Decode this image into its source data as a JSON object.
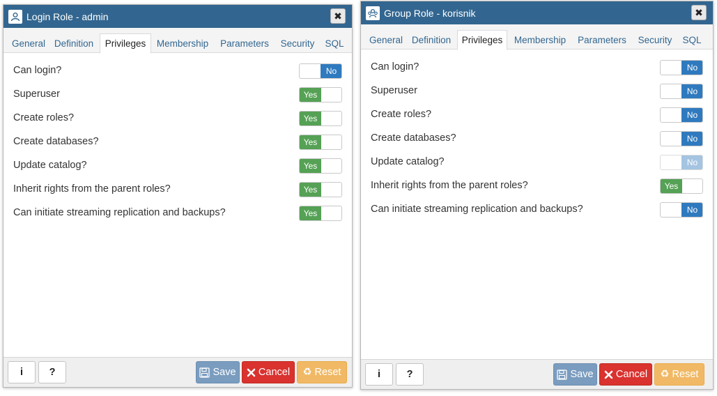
{
  "dialogs": [
    {
      "title": "Login Role - admin",
      "icon": "user-role-icon",
      "close_glyph": "✖",
      "tabs": [
        "General",
        "Definition",
        "Privileges",
        "Membership",
        "Parameters",
        "Security",
        "SQL"
      ],
      "active_tab": "Privileges",
      "privileges": [
        {
          "label": "Can login?",
          "value": "No"
        },
        {
          "label": "Superuser",
          "value": "Yes"
        },
        {
          "label": "Create roles?",
          "value": "Yes"
        },
        {
          "label": "Create databases?",
          "value": "Yes"
        },
        {
          "label": "Update catalog?",
          "value": "Yes"
        },
        {
          "label": "Inherit rights from the parent roles?",
          "value": "Yes"
        },
        {
          "label": "Can initiate streaming replication and backups?",
          "value": "Yes"
        }
      ],
      "footer": {
        "info": "i",
        "help": "?",
        "save": "Save",
        "cancel": "Cancel",
        "reset": "Reset"
      }
    },
    {
      "title": "Group Role - korisnik",
      "icon": "group-role-icon",
      "close_glyph": "✖",
      "tabs": [
        "General",
        "Definition",
        "Privileges",
        "Membership",
        "Parameters",
        "Security",
        "SQL"
      ],
      "active_tab": "Privileges",
      "privileges": [
        {
          "label": "Can login?",
          "value": "No"
        },
        {
          "label": "Superuser",
          "value": "No"
        },
        {
          "label": "Create roles?",
          "value": "No"
        },
        {
          "label": "Create databases?",
          "value": "No"
        },
        {
          "label": "Update catalog?",
          "value": "No",
          "disabled": true
        },
        {
          "label": "Inherit rights from the parent roles?",
          "value": "Yes"
        },
        {
          "label": "Can initiate streaming replication and backups?",
          "value": "No"
        }
      ],
      "footer": {
        "info": "i",
        "help": "?",
        "save": "Save",
        "cancel": "Cancel",
        "reset": "Reset"
      }
    }
  ],
  "colors": {
    "titlebar": "#326690",
    "tab_link": "#326690",
    "toggle_no": "#2f7abf",
    "toggle_yes": "#55a155",
    "toggle_disabled": "#a4c4e2",
    "save": "#7a9cbf",
    "cancel": "#d9322f",
    "reset": "#f1b965"
  }
}
